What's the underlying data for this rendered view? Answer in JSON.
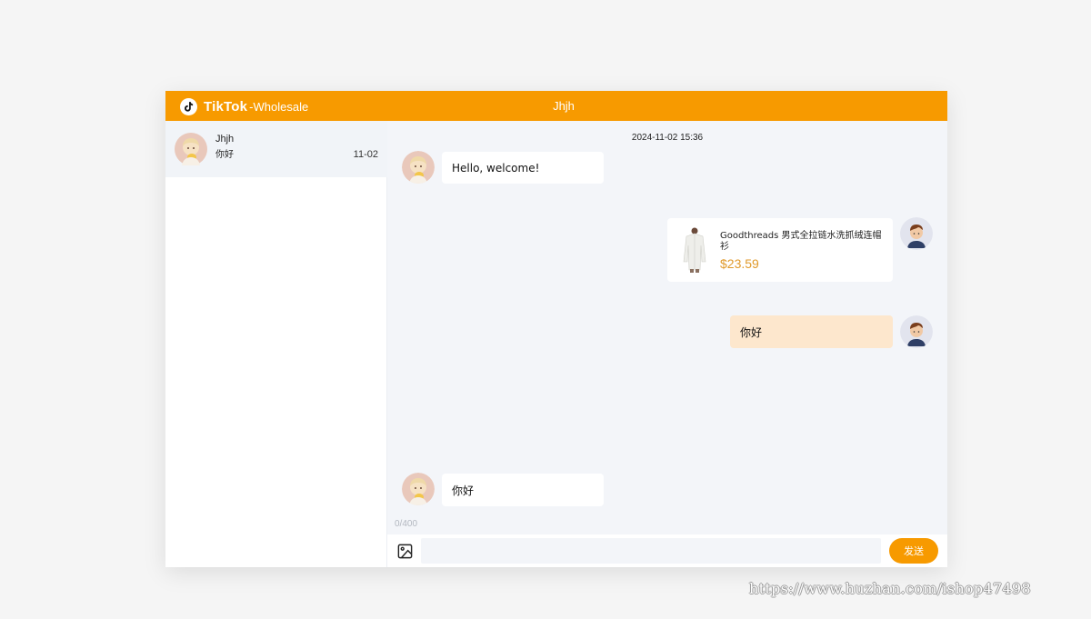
{
  "app": {
    "brand_name": "TikTok",
    "brand_suffix": "-Wholesale",
    "header_title": "Jhjh"
  },
  "colors": {
    "accent": "#f79a00",
    "price": "#e09a2b",
    "own_bubble": "#fde7cd",
    "chat_bg": "#f3f5f9"
  },
  "conversations": [
    {
      "name": "Jhjh",
      "last_message": "你好",
      "date": "11-02",
      "avatar": "anime-girl-avatar",
      "active": true
    }
  ],
  "chat": {
    "timestamp": "2024-11-02 15:36",
    "messages": [
      {
        "from": "contact",
        "type": "text",
        "text": "Hello, welcome!"
      },
      {
        "from": "me",
        "type": "product",
        "title": "Goodthreads 男式全拉链水洗抓绒连帽衫",
        "price": "$23.59",
        "image": "white-hoodie-product"
      },
      {
        "from": "me",
        "type": "text",
        "text": "你好"
      },
      {
        "from": "contact",
        "type": "text",
        "text": "你好"
      }
    ]
  },
  "composer": {
    "char_count": "0/400",
    "value": "",
    "placeholder": "",
    "send_label": "发送",
    "image_icon": "image-icon"
  },
  "watermark": "https://www.huzhan.com/ishop47498"
}
